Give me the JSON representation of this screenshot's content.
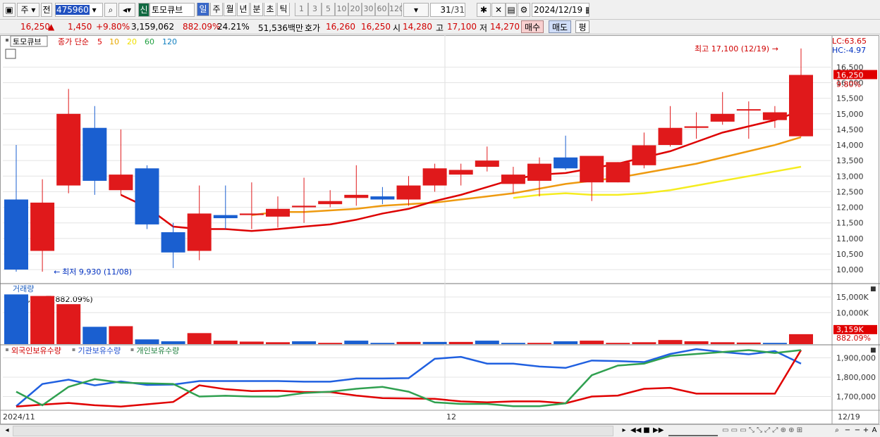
{
  "toolbar": {
    "market": "주",
    "type": "전",
    "code": "475960",
    "badge": "신",
    "name": "토모큐브",
    "periods": [
      "일",
      "주",
      "월",
      "년",
      "분",
      "초",
      "틱"
    ],
    "nums": [
      "1",
      "3",
      "5",
      "10",
      "20",
      "30",
      "60",
      "120"
    ],
    "count": "31",
    "total": "/31",
    "date": "2024/12/19"
  },
  "quote": {
    "price": "16,250",
    "arrow": "▲",
    "change": "1,450",
    "pct": "+9.80%",
    "volume": "3,159,062",
    "vol_ratio": "882.09%",
    "turnover": "24.21%",
    "amount": "51,536백만",
    "hoga_label": "호가",
    "ask": "16,260",
    "bid": "16,250",
    "open_label": "시",
    "open": "14,280",
    "high_label": "고",
    "high": "17,100",
    "low_label": "저",
    "low": "14,270",
    "buy": "매수",
    "sell": "매도",
    "eval": "평"
  },
  "legend": {
    "name": "토모큐브",
    "ma_label": "종가 단순",
    "ma_periods": [
      "5",
      "10",
      "20",
      "60",
      "120"
    ],
    "ma_colors": [
      "#dd0000",
      "#e8a800",
      "#f0e000",
      "#20a040",
      "#1080c0"
    ]
  },
  "annotations": {
    "high": "최고 17,100 (12/19)",
    "low": "최저 9,930 (11/08)",
    "lc": "LC:63.65",
    "hc": "HC:-4.97",
    "last_price": "16,250",
    "last_pct": "9.80%",
    "vol_info": "3,159,062주(882.09%)",
    "vol_last": "3,159K",
    "vol_last_pct": "882.09%",
    "date_start": "2024/11",
    "date_mid": "12",
    "date_end": "12/19"
  },
  "colors": {
    "up": "#e0191b",
    "down": "#1a5fd0",
    "ma5": "#dd0000",
    "ma10": "#ee9a10",
    "ma20": "#f5ec20",
    "foreign": "#2060e0",
    "inst": "#e00000",
    "indiv": "#30a050"
  },
  "chart_data": [
    {
      "type": "candlestick",
      "title": "",
      "ylim": [
        9550,
        17300
      ],
      "yticks": [
        "16,500",
        "16,000",
        "15,500",
        "15,000",
        "14,500",
        "14,000",
        "13,500",
        "13,000",
        "12,500",
        "12,000",
        "11,500",
        "11,000",
        "10,500",
        "10,000"
      ],
      "candles": [
        [
          12250,
          14000,
          9930,
          10000
        ],
        [
          10600,
          12900,
          9930,
          12150
        ],
        [
          12700,
          15800,
          12450,
          15000
        ],
        [
          14550,
          15250,
          12400,
          12850
        ],
        [
          12550,
          14500,
          12400,
          13050
        ],
        [
          13250,
          13350,
          11300,
          11450
        ],
        [
          11200,
          11500,
          10050,
          10550
        ],
        [
          10600,
          12700,
          10300,
          11800
        ],
        [
          11750,
          12700,
          11300,
          11650
        ],
        [
          11750,
          12800,
          11300,
          11800
        ],
        [
          11700,
          12350,
          11350,
          11950
        ],
        [
          12000,
          12950,
          11500,
          12050
        ],
        [
          12100,
          12550,
          12000,
          12200
        ],
        [
          12300,
          13350,
          12050,
          12400
        ],
        [
          12350,
          12650,
          12100,
          12250
        ],
        [
          12250,
          13000,
          12050,
          12700
        ],
        [
          12700,
          13400,
          12500,
          13250
        ],
        [
          13050,
          13400,
          12700,
          13200
        ],
        [
          13300,
          13950,
          13150,
          13500
        ],
        [
          12750,
          13300,
          12450,
          13050
        ],
        [
          12850,
          13600,
          12350,
          13400
        ],
        [
          13600,
          14300,
          13200,
          13250
        ],
        [
          12800,
          13500,
          12200,
          13650
        ],
        [
          12800,
          13450,
          12800,
          13450
        ],
        [
          13350,
          14400,
          13250,
          13990
        ],
        [
          14000,
          15250,
          13950,
          14550
        ],
        [
          14550,
          15050,
          14200,
          14600
        ],
        [
          14750,
          15700,
          14650,
          15000
        ],
        [
          15150,
          15400,
          14200,
          15150
        ],
        [
          14800,
          15250,
          14550,
          15050
        ],
        [
          14280,
          17100,
          14270,
          16250
        ]
      ],
      "ma5": [
        null,
        null,
        null,
        null,
        12400,
        12000,
        11380,
        11300,
        11300,
        11240,
        11300,
        11380,
        11450,
        11600,
        11800,
        11950,
        12200,
        12400,
        12650,
        12900,
        13050,
        13100,
        13250,
        13400,
        13600,
        13800,
        14100,
        14400,
        14600,
        14800,
        15100
      ],
      "ma10": [
        null,
        null,
        null,
        null,
        null,
        null,
        null,
        null,
        null,
        11750,
        11850,
        11850,
        11900,
        11950,
        12050,
        12100,
        12150,
        12250,
        12350,
        12450,
        12600,
        12750,
        12850,
        12950,
        13100,
        13250,
        13400,
        13600,
        13800,
        14000,
        14250
      ],
      "ma20": [
        null,
        null,
        null,
        null,
        null,
        null,
        null,
        null,
        null,
        null,
        null,
        null,
        null,
        null,
        null,
        null,
        null,
        null,
        null,
        12300,
        12400,
        12450,
        12400,
        12400,
        12450,
        12550,
        12700,
        12850,
        13000,
        13150,
        13300
      ]
    },
    {
      "type": "bar",
      "title": "거래량",
      "ylim": [
        0,
        17000
      ],
      "yticks": [
        "15,000K",
        "10,000K"
      ],
      "values": [
        [
          15800,
          -1
        ],
        [
          15300,
          1
        ],
        [
          12700,
          1
        ],
        [
          5500,
          -1
        ],
        [
          5700,
          1
        ],
        [
          1500,
          -1
        ],
        [
          900,
          -1
        ],
        [
          3500,
          1
        ],
        [
          1100,
          1
        ],
        [
          800,
          1
        ],
        [
          600,
          1
        ],
        [
          900,
          -1
        ],
        [
          400,
          1
        ],
        [
          1100,
          -1
        ],
        [
          400,
          -1
        ],
        [
          700,
          1
        ],
        [
          700,
          -1
        ],
        [
          700,
          1
        ],
        [
          1100,
          -1
        ],
        [
          400,
          -1
        ],
        [
          400,
          1
        ],
        [
          900,
          -1
        ],
        [
          1100,
          1
        ],
        [
          400,
          1
        ],
        [
          600,
          1
        ],
        [
          1300,
          1
        ],
        [
          900,
          1
        ],
        [
          600,
          1
        ],
        [
          500,
          1
        ],
        [
          400,
          -1
        ],
        [
          3159,
          1
        ]
      ]
    },
    {
      "type": "line",
      "title": "",
      "ylim": [
        1640000,
        1960000
      ],
      "yticks": [
        "1,900,000",
        "1,800,000",
        "1,700,000"
      ],
      "series": [
        {
          "name": "외국인보유수량",
          "values": [
            1650000,
            1765000,
            1787000,
            1758000,
            1778000,
            1760000,
            1762000,
            1780000,
            1780000,
            1780000,
            1780000,
            1777000,
            1777000,
            1793000,
            1793000,
            1795000,
            1895000,
            1905000,
            1870000,
            1870000,
            1855000,
            1848000,
            1886000,
            1883000,
            1878000,
            1920000,
            1945000,
            1930000,
            1918000,
            1935000,
            1870000
          ]
        },
        {
          "name": "기관보유수량",
          "values": [
            1648000,
            1658000,
            1667000,
            1655000,
            1648000,
            1660000,
            1672000,
            1758000,
            1738000,
            1728000,
            1730000,
            1723000,
            1723000,
            1705000,
            1692000,
            1690000,
            1688000,
            1675000,
            1670000,
            1675000,
            1675000,
            1665000,
            1700000,
            1705000,
            1740000,
            1745000,
            1715000,
            1715000,
            1715000,
            1715000,
            1940000
          ]
        },
        {
          "name": "개인보유수량",
          "values": [
            1725000,
            1655000,
            1750000,
            1790000,
            1772000,
            1768000,
            1765000,
            1700000,
            1704000,
            1700000,
            1700000,
            1718000,
            1725000,
            1740000,
            1750000,
            1725000,
            1670000,
            1662000,
            1662000,
            1650000,
            1650000,
            1665000,
            1810000,
            1860000,
            1870000,
            1910000,
            1920000,
            1930000,
            1940000,
            1925000,
            1940000
          ]
        }
      ]
    }
  ]
}
